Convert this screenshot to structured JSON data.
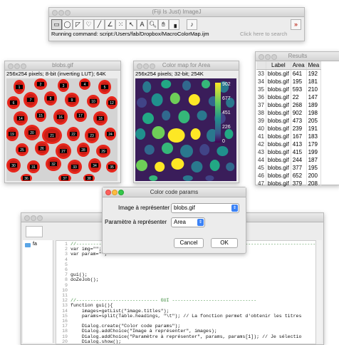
{
  "imagej": {
    "title": "(Fiji Is Just) ImageJ",
    "status": "Running command: script:/Users/fab/Dropbox/MacroColorMap.ijm",
    "search_placeholder": "Click here to search",
    "tools": [
      "rectangle-tool",
      "oval-tool",
      "polygon-tool",
      "freehand-tool",
      "line-tool",
      "angle-tool",
      "point-tool",
      "wand-tool",
      "text-tool",
      "magnifier-tool",
      "hand-tool",
      "dropper-tool",
      "custom-tool",
      "more-tools"
    ]
  },
  "blobs": {
    "title": "blobs.gif",
    "info": "256x254 pixels; 8-bit (inverting LUT); 64K",
    "labels": [
      "1",
      "2",
      "3",
      "4",
      "5",
      "6",
      "7",
      "8",
      "9",
      "10",
      "12",
      "14",
      "15",
      "16",
      "17",
      "18",
      "19",
      "20",
      "21",
      "22",
      "23",
      "24",
      "25",
      "26",
      "27",
      "28",
      "29",
      "30",
      "31",
      "32",
      "33",
      "34",
      "35",
      "36",
      "37",
      "38",
      "39",
      "40",
      "41",
      "42",
      "43",
      "44",
      "45",
      "46",
      "47",
      "48",
      "49",
      "50",
      "51",
      "52",
      "53",
      "54",
      "55",
      "56",
      "57",
      "58",
      "59",
      "60",
      "61",
      "62",
      "63",
      "64"
    ]
  },
  "colormap": {
    "title": "Color map for Area",
    "info": "256x254 pixels; 32-bit; 254K",
    "legend_ticks": [
      "902",
      "677",
      "451",
      "226",
      "0"
    ]
  },
  "results": {
    "title": "Results",
    "columns": [
      "",
      "Label",
      "Area",
      "Mea"
    ],
    "rows": [
      [
        "33",
        "blobs.gif",
        "641",
        "192"
      ],
      [
        "34",
        "blobs.gif",
        "195",
        "181"
      ],
      [
        "35",
        "blobs.gif",
        "593",
        "210"
      ],
      [
        "36",
        "blobs.gif",
        "22",
        "147"
      ],
      [
        "37",
        "blobs.gif",
        "268",
        "189"
      ],
      [
        "38",
        "blobs.gif",
        "902",
        "198"
      ],
      [
        "39",
        "blobs.gif",
        "473",
        "205"
      ],
      [
        "40",
        "blobs.gif",
        "239",
        "191"
      ],
      [
        "41",
        "blobs.gif",
        "167",
        "183"
      ],
      [
        "42",
        "blobs.gif",
        "413",
        "179"
      ],
      [
        "43",
        "blobs.gif",
        "415",
        "199"
      ],
      [
        "44",
        "blobs.gif",
        "244",
        "187"
      ],
      [
        "45",
        "blobs.gif",
        "377",
        "195"
      ],
      [
        "46",
        "blobs.gif",
        "652",
        "200"
      ],
      [
        "47",
        "blobs.gif",
        "379",
        "208"
      ]
    ]
  },
  "dialog": {
    "title": "Color code params",
    "image_label": "Image à représenter",
    "image_value": "blobs.gif",
    "param_label": "Paramètre à représenter",
    "param_value": "Area",
    "cancel": "Cancel",
    "ok": "OK"
  },
  "editor": {
    "sidebar_folder": "fa",
    "lines": [
      {
        "n": "1",
        "text": "//-------------------------------------------------------------------------------------"
      },
      {
        "n": "2",
        "text": "var img=\"\";"
      },
      {
        "n": "3",
        "text": "var param=\"\";"
      },
      {
        "n": "4",
        "text": ""
      },
      {
        "n": "5",
        "text": ""
      },
      {
        "n": "6",
        "text": ""
      },
      {
        "n": "7",
        "text": "gui();"
      },
      {
        "n": "8",
        "text": "doZeJob();"
      },
      {
        "n": "9",
        "text": ""
      },
      {
        "n": "10",
        "text": ""
      },
      {
        "n": "11",
        "text": ""
      },
      {
        "n": "12",
        "text": "//----------------------------- GUI ------------------------------"
      },
      {
        "n": "13",
        "text": "function gui(){"
      },
      {
        "n": "14",
        "text": "    images=getList(\"image.titles\");"
      },
      {
        "n": "15",
        "text": "    params=split(Table.headings, \"\\t\"); // La fonction permet d'obtenir les titres"
      },
      {
        "n": "16",
        "text": ""
      },
      {
        "n": "17",
        "text": "    Dialog.create(\"Color code params\");"
      },
      {
        "n": "18",
        "text": "    Dialog.addChoice(\"Image à représenter\", images);"
      },
      {
        "n": "19",
        "text": "    Dialog.addChoice(\"Paramètre à représenter\", params, params[1]); // Je sélectio"
      },
      {
        "n": "20",
        "text": "    Dialog.show();"
      }
    ]
  },
  "colors": {
    "viridis_bg": "#3a1d5a",
    "blob_red": "#e8261c",
    "dialog_accent": "#3b82f6"
  }
}
